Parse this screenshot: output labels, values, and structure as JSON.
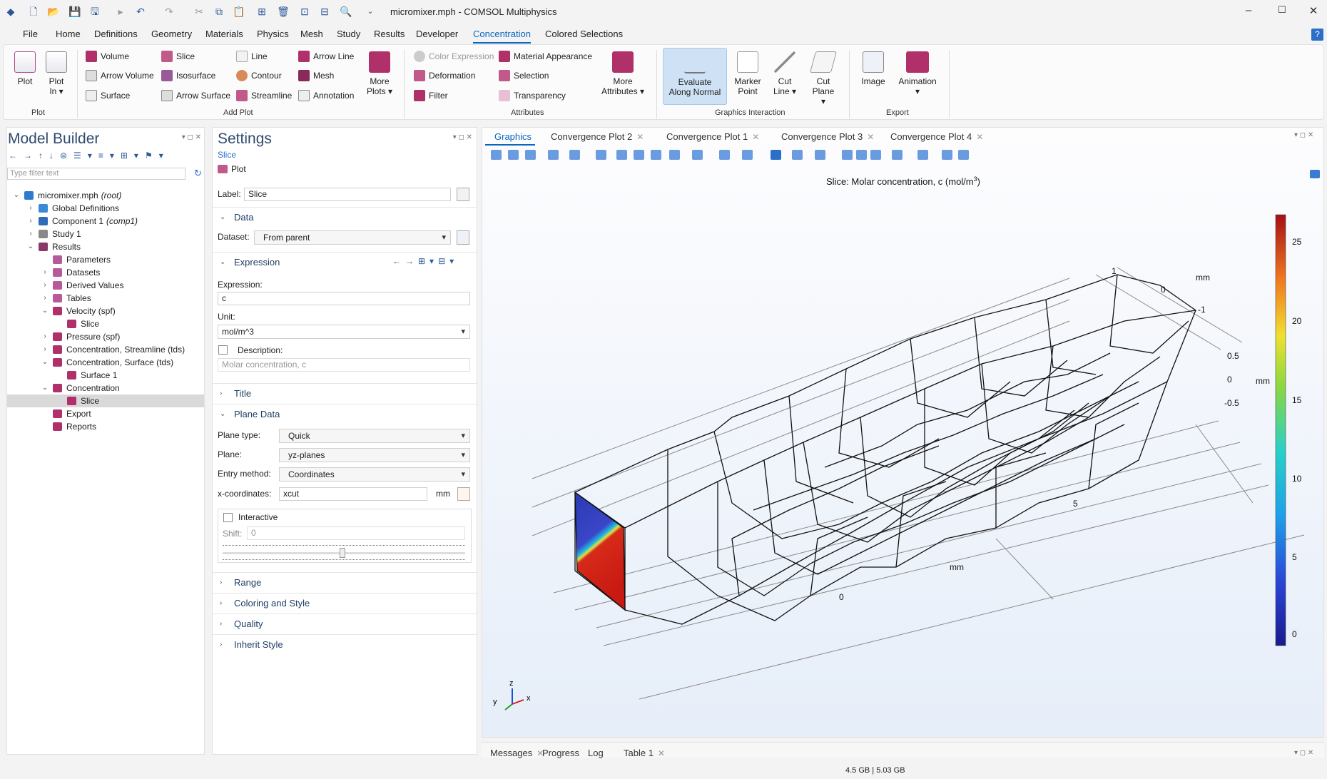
{
  "window": {
    "title": "micromixer.mph - COMSOL Multiphysics",
    "min": "–",
    "max": "☐",
    "close": "✕",
    "help": "?"
  },
  "menu": [
    "File",
    "Home",
    "Definitions",
    "Geometry",
    "Materials",
    "Physics",
    "Mesh",
    "Study",
    "Results",
    "Developer",
    "Concentration",
    "Colored Selections"
  ],
  "menu_active": "Concentration",
  "ribbon": {
    "plot": {
      "plot": "Plot",
      "plot_in_1": "Plot",
      "plot_in_2": "In ▾",
      "group": "Plot"
    },
    "add_plot": {
      "volume": "Volume",
      "arrow_volume": "Arrow Volume",
      "surface": "Surface",
      "slice": "Slice",
      "isosurface": "Isosurface",
      "arrow_surface": "Arrow Surface",
      "line": "Line",
      "contour": "Contour",
      "streamline": "Streamline",
      "arrow_line": "Arrow Line",
      "mesh": "Mesh",
      "annotation": "Annotation",
      "more_plots_1": "More",
      "more_plots_2": "Plots ▾",
      "group": "Add Plot"
    },
    "attributes": {
      "color_expression": "Color Expression",
      "deformation": "Deformation",
      "filter": "Filter",
      "material_appearance": "Material Appearance",
      "selection": "Selection",
      "transparency": "Transparency",
      "more_attr_1": "More",
      "more_attr_2": "Attributes ▾",
      "group": "Attributes"
    },
    "graphics_interaction": {
      "evaluate_1": "Evaluate",
      "evaluate_2": "Along Normal",
      "marker_1": "Marker",
      "marker_2": "Point",
      "cutline_1": "Cut",
      "cutline_2": "Line ▾",
      "cutplane_1": "Cut",
      "cutplane_2": "Plane ▾",
      "group": "Graphics Interaction"
    },
    "export": {
      "image": "Image",
      "animation": "Animation",
      "animation_2": "▾",
      "group": "Export"
    }
  },
  "model_builder": {
    "title": "Model Builder",
    "filter_placeholder": "Type filter text",
    "tree": [
      {
        "label": "micromixer.mph",
        "suffix": "(root)",
        "indent": 0,
        "toggle": "v",
        "icon": "#2d7bd0"
      },
      {
        "label": "Global Definitions",
        "suffix": "",
        "indent": 1,
        "toggle": ">",
        "icon": "#3a8ad8"
      },
      {
        "label": "Component 1",
        "suffix": "(comp1)",
        "indent": 1,
        "toggle": ">",
        "icon": "#2d6cb8"
      },
      {
        "label": "Study 1",
        "suffix": "",
        "indent": 1,
        "toggle": ">",
        "icon": "#888"
      },
      {
        "label": "Results",
        "suffix": "",
        "indent": 1,
        "toggle": "v",
        "icon": "#8a3a6a"
      },
      {
        "label": "Parameters",
        "suffix": "",
        "indent": 2,
        "toggle": "",
        "icon": "#b85a9a"
      },
      {
        "label": "Datasets",
        "suffix": "",
        "indent": 2,
        "toggle": ">",
        "icon": "#b85a9a"
      },
      {
        "label": "Derived Values",
        "suffix": "",
        "indent": 2,
        "toggle": ">",
        "icon": "#b85a9a"
      },
      {
        "label": "Tables",
        "suffix": "",
        "indent": 2,
        "toggle": ">",
        "icon": "#b85a9a"
      },
      {
        "label": "Velocity (spf)",
        "suffix": "",
        "indent": 2,
        "toggle": "v",
        "icon": "#b0306a"
      },
      {
        "label": "Slice",
        "suffix": "",
        "indent": 3,
        "toggle": "",
        "icon": "#b0306a"
      },
      {
        "label": "Pressure (spf)",
        "suffix": "",
        "indent": 2,
        "toggle": ">",
        "icon": "#b0306a"
      },
      {
        "label": "Concentration, Streamline (tds)",
        "suffix": "",
        "indent": 2,
        "toggle": ">",
        "icon": "#b0306a"
      },
      {
        "label": "Concentration, Surface (tds)",
        "suffix": "",
        "indent": 2,
        "toggle": "v",
        "icon": "#b0306a"
      },
      {
        "label": "Surface 1",
        "suffix": "",
        "indent": 3,
        "toggle": "",
        "icon": "#b0306a"
      },
      {
        "label": "Concentration",
        "suffix": "",
        "indent": 2,
        "toggle": "v",
        "icon": "#b0306a"
      },
      {
        "label": "Slice",
        "suffix": "",
        "indent": 3,
        "toggle": "",
        "icon": "#b0306a",
        "selected": true
      },
      {
        "label": "Export",
        "suffix": "",
        "indent": 2,
        "toggle": "",
        "icon": "#b0306a"
      },
      {
        "label": "Reports",
        "suffix": "",
        "indent": 2,
        "toggle": "",
        "icon": "#b0306a"
      }
    ]
  },
  "settings": {
    "title": "Settings",
    "subtitle": "Slice",
    "plot_button": "Plot",
    "label_field": "Label:",
    "label_value": "Slice",
    "data_section": "Data",
    "dataset_label": "Dataset:",
    "dataset_value": "From parent",
    "expression_section": "Expression",
    "expression_label": "Expression:",
    "expression_value": "c",
    "unit_label": "Unit:",
    "unit_value": "mol/m^3",
    "description_label": "Description:",
    "description_value": "Molar concentration, c",
    "title_section": "Title",
    "plane_section": "Plane Data",
    "plane_type_label": "Plane type:",
    "plane_type_value": "Quick",
    "plane_label": "Plane:",
    "plane_value": "yz-planes",
    "entry_label": "Entry method:",
    "entry_value": "Coordinates",
    "xcoord_label": "x-coordinates:",
    "xcoord_value": "xcut",
    "xcoord_unit": "mm",
    "interactive_label": "Interactive",
    "shift_label": "Shift:",
    "shift_value": "0",
    "range_section": "Range",
    "coloring_section": "Coloring and Style",
    "quality_section": "Quality",
    "inherit_section": "Inherit Style"
  },
  "graphics": {
    "tabs": [
      "Graphics",
      "Convergence Plot 2",
      "Convergence Plot 1",
      "Convergence Plot 3",
      "Convergence Plot 4"
    ],
    "plot_title_pre": "Slice: Molar concentration, c (mol/m",
    "plot_title_sup": "3",
    "plot_title_post": ")",
    "axis_labels": {
      "mm_top": "mm",
      "t1": "1",
      "t0": "0",
      "tm1": "-1",
      "z05": "0.5",
      "z0": "0",
      "zm05": "-0.5",
      "mm_right": "mm",
      "x5": "5",
      "x0": "0",
      "mm_bottom": "mm"
    },
    "triad": {
      "x": "x",
      "y": "y",
      "z": "z"
    },
    "colorbar_ticks": [
      "25",
      "20",
      "15",
      "10",
      "5",
      "0"
    ],
    "colors": {
      "low": "#1a1a8c",
      "high": "#a50f15"
    }
  },
  "bottom_tabs": [
    "Messages",
    "Progress",
    "Log",
    "Table 1"
  ],
  "status": {
    "memory": "4.5 GB | 5.03 GB"
  }
}
